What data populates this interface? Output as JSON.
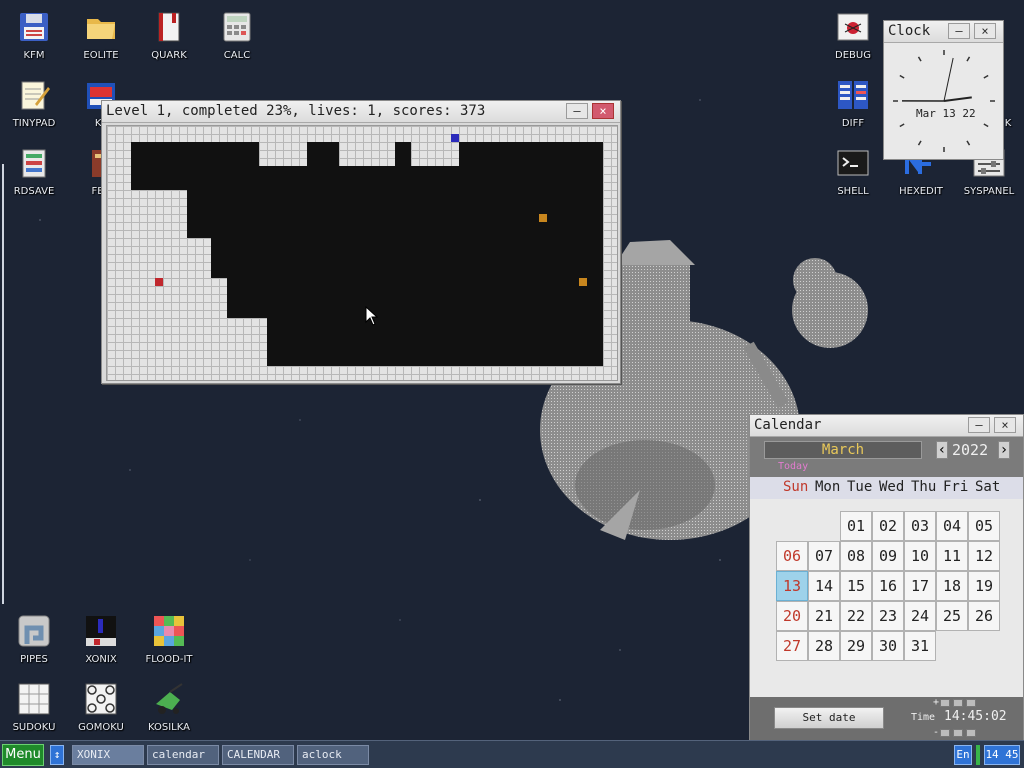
{
  "desktop_icons": [
    {
      "id": "kfm",
      "label": "KFM",
      "icon": "floppy-icon"
    },
    {
      "id": "eolite",
      "label": "EOLITE",
      "icon": "folder-icon"
    },
    {
      "id": "quark",
      "label": "QUARK",
      "icon": "book-icon"
    },
    {
      "id": "calc",
      "label": "CALC",
      "icon": "calculator-icon"
    },
    {
      "id": "tinypad",
      "label": "TINYPAD",
      "icon": "notepad-icon"
    },
    {
      "id": "kf",
      "label": "KF",
      "icon": "kf-icon"
    },
    {
      "id": "rdsave",
      "label": "RDSAVE",
      "icon": "rdsave-icon"
    },
    {
      "id": "fb2",
      "label": "FB2",
      "icon": "fb2-icon"
    },
    {
      "id": "pipes",
      "label": "PIPES",
      "icon": "pipes-icon"
    },
    {
      "id": "xonix",
      "label": "XONIX",
      "icon": "xonix-icon"
    },
    {
      "id": "flood-it",
      "label": "FLOOD-IT",
      "icon": "flood-it-icon"
    },
    {
      "id": "sudoku",
      "label": "SUDOKU",
      "icon": "sudoku-icon"
    },
    {
      "id": "gomoku",
      "label": "GOMOKU",
      "icon": "gomoku-icon"
    },
    {
      "id": "kosilka",
      "label": "KOSILKA",
      "icon": "lawnmower-icon"
    },
    {
      "id": "debug",
      "label": "DEBUG",
      "icon": "bug-icon"
    },
    {
      "id": "diff",
      "label": "DIFF",
      "icon": "diff-icon"
    },
    {
      "id": "shell",
      "label": "SHELL",
      "icon": "terminal-icon"
    },
    {
      "id": "hexedit",
      "label": "HEXEDIT",
      "icon": "hexedit-icon"
    },
    {
      "id": "syspanel",
      "label": "SYSPANEL",
      "icon": "sliders-icon"
    },
    {
      "id": "k",
      "label": "K",
      "icon": "k-icon"
    }
  ],
  "game_window": {
    "title": "Level 1, completed 23%, lives: 1, scores: 373",
    "minimize": "–",
    "close": "×",
    "colors": {
      "player": "#c0272d",
      "enemy": "#c8861e",
      "wall_enemy": "#2b2bbb"
    }
  },
  "clock_window": {
    "title": "Clock",
    "date": "Mar 13 22",
    "minimize": "–",
    "close": "×",
    "time": {
      "hour": 14,
      "minute": 45,
      "second": 2
    }
  },
  "calendar_window": {
    "title": "Calendar",
    "minimize": "–",
    "close": "×",
    "month": "March",
    "year": "2022",
    "prev": "‹",
    "next": "›",
    "today_label": "Today",
    "weekdays": [
      "Sun",
      "Mon",
      "Tue",
      "Wed",
      "Thu",
      "Fri",
      "Sat"
    ],
    "weeks": [
      [
        "",
        "01",
        "02",
        "03",
        "04",
        "05"
      ],
      [
        "06",
        "07",
        "08",
        "09",
        "10",
        "11",
        "12"
      ],
      [
        "13",
        "14",
        "15",
        "16",
        "17",
        "18",
        "19"
      ],
      [
        "20",
        "21",
        "22",
        "23",
        "24",
        "25",
        "26"
      ],
      [
        "27",
        "28",
        "29",
        "30",
        "31"
      ]
    ],
    "selected_day": "13",
    "set_date_label": "Set date",
    "time_label": "Time",
    "time_value": "14:45:02",
    "plus": "+",
    "minus": "-"
  },
  "taskbar": {
    "menu_label": "Menu",
    "switch_icon": "↕",
    "tasks": [
      "XONIX",
      "calendar",
      "CALENDAR",
      "aclock"
    ],
    "lang": "En",
    "clock": "14 45"
  }
}
